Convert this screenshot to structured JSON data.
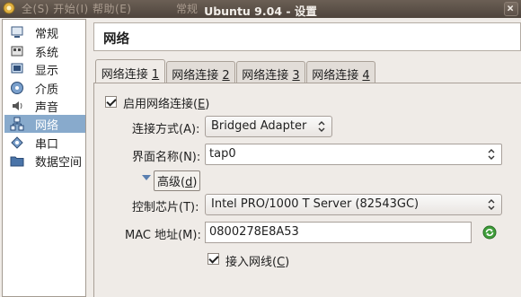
{
  "titlebar": {
    "title": "Ubuntu 9.04 - 设置",
    "background_menu": "全(S)   开始(I)   帮助(E)",
    "background_tab": "常规"
  },
  "sidebar": {
    "items": [
      {
        "label": "常规",
        "icon": "general-icon"
      },
      {
        "label": "系统",
        "icon": "system-icon"
      },
      {
        "label": "显示",
        "icon": "display-icon"
      },
      {
        "label": "介质",
        "icon": "storage-icon"
      },
      {
        "label": "声音",
        "icon": "audio-icon"
      },
      {
        "label": "网络",
        "icon": "network-icon",
        "selected": true
      },
      {
        "label": "串口",
        "icon": "serial-port-icon"
      },
      {
        "label": "数据空间",
        "icon": "shared-folder-icon"
      }
    ]
  },
  "page": {
    "title": "网络"
  },
  "tabs": [
    {
      "text": "网络连接 ",
      "key": "1",
      "active": true
    },
    {
      "text": "网络连接 ",
      "key": "2"
    },
    {
      "text": "网络连接 ",
      "key": "3"
    },
    {
      "text": "网络连接 ",
      "key": "4"
    }
  ],
  "form": {
    "enable_adapter": {
      "label": "启用网络连接(",
      "key": "E",
      "close": ")",
      "checked": true
    },
    "attached_to": {
      "label": "连接方式(A):",
      "value": "Bridged Adapter"
    },
    "interface_name": {
      "label": "界面名称(N):",
      "value": "tap0"
    },
    "advanced": {
      "label": "高级(",
      "key": "d",
      "close": ")",
      "expanded": true
    },
    "adapter_type": {
      "label": "控制芯片(T):",
      "value": "Intel PRO/1000 T Server (82543GC)"
    },
    "mac_address": {
      "label": "MAC 地址(M):",
      "value": "0800278E8A53"
    },
    "cable_connected": {
      "label": "接入网线(",
      "key": "C",
      "close": ")",
      "checked": true
    }
  },
  "colors": {
    "selection": "#88aacc",
    "titlebar": "#5c5048"
  }
}
